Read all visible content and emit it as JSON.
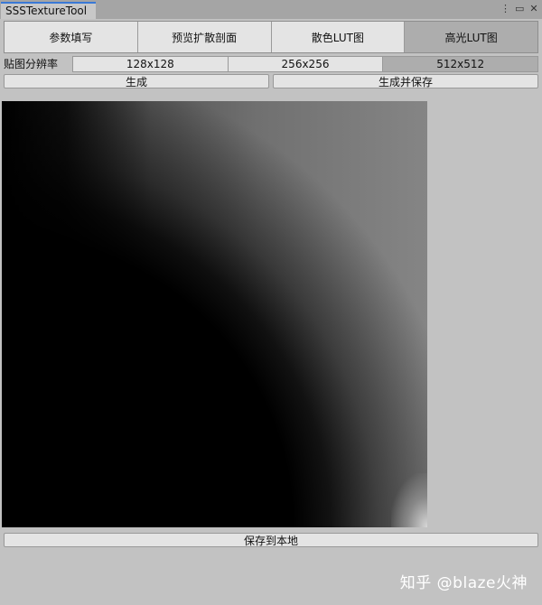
{
  "window": {
    "tab_title": "SSSTextureTool",
    "icons": [
      "more-icon",
      "maximize-icon",
      "close-icon"
    ]
  },
  "toolbar": {
    "tabs": [
      {
        "label": "参数填写",
        "active": false
      },
      {
        "label": "预览扩散剖面",
        "active": false
      },
      {
        "label": "散色LUT图",
        "active": false
      },
      {
        "label": "高光LUT图",
        "active": true
      }
    ]
  },
  "resolution": {
    "label": "贴图分辨率",
    "options": [
      "128x128",
      "256x256",
      "512x512"
    ],
    "selected": "512x512"
  },
  "actions": {
    "generate": "生成",
    "generate_and_save": "生成并保存"
  },
  "footer": {
    "save_local": "保存到本地"
  },
  "watermark": "知乎 @blaze火神"
}
